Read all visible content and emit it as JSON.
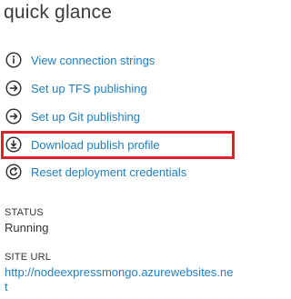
{
  "panel": {
    "title": "quick glance"
  },
  "actions": [
    {
      "label": "View connection strings",
      "icon": "info-circle-icon"
    },
    {
      "label": "Set up TFS publishing",
      "icon": "arrow-right-circle-icon"
    },
    {
      "label": "Set up Git publishing",
      "icon": "arrow-right-circle-icon"
    },
    {
      "label": "Download publish profile",
      "icon": "download-circle-icon"
    },
    {
      "label": "Reset deployment credentials",
      "icon": "refresh-circle-icon"
    }
  ],
  "status": {
    "label": "STATUS",
    "value": "Running"
  },
  "site_url": {
    "label": "SITE URL",
    "value": "http://nodeexpressmongo.azurewebsites.net"
  },
  "colors": {
    "link": "#1e7fc2",
    "highlight": "#e3202a",
    "text": "#333333"
  }
}
